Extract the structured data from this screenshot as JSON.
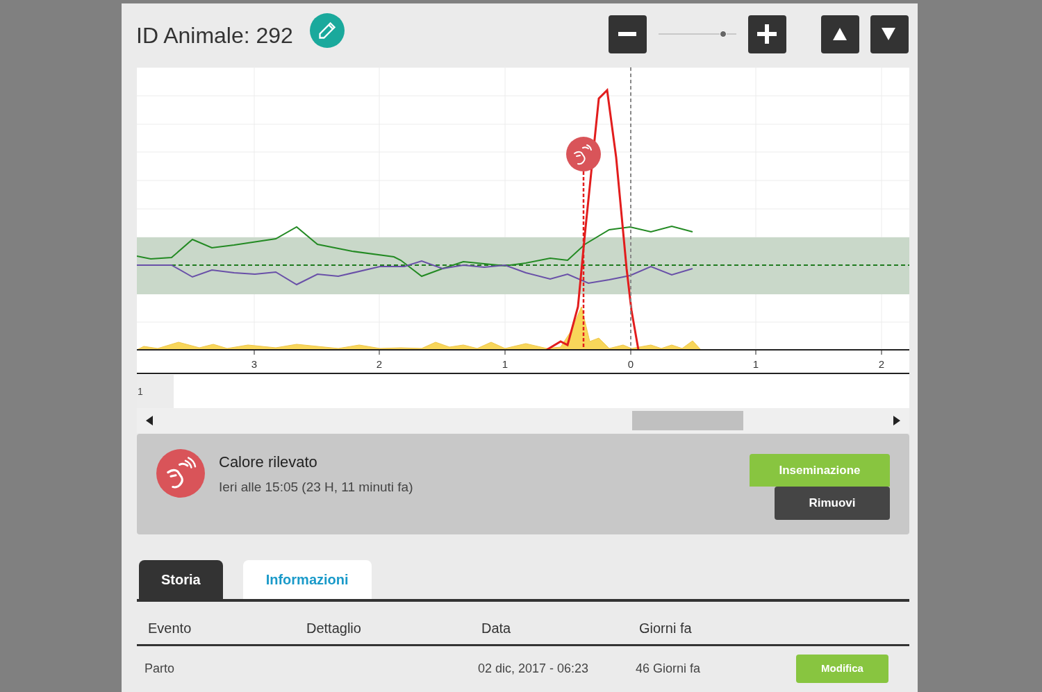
{
  "header": {
    "title": "ID Animale: 292",
    "zoom": {
      "level": 0.86
    }
  },
  "chart": {
    "x_tick_labels": [
      "3",
      "2",
      "1",
      "0",
      "1",
      "2"
    ],
    "row_label": "1"
  },
  "alert": {
    "title": "Calore rilevato",
    "subtitle": "Ieri alle 15:05 (23 H, 11 minuti fa)",
    "buttons": [
      {
        "label": "Inseminazione",
        "kind": "primary"
      },
      {
        "label": "Rimuovi",
        "kind": "secondary"
      }
    ]
  },
  "tabs": [
    {
      "label": "Storia",
      "selected": true
    },
    {
      "label": "Informazioni",
      "selected": false
    }
  ],
  "table": {
    "columns": [
      "Evento",
      "Dettaglio",
      "Data",
      "Giorni fa"
    ],
    "rows": [
      {
        "evento": "Parto",
        "data": "02 dic, 2017 - 06:23",
        "giorni_fa": "46 Giorni fa",
        "action": "Modifica"
      }
    ]
  }
}
